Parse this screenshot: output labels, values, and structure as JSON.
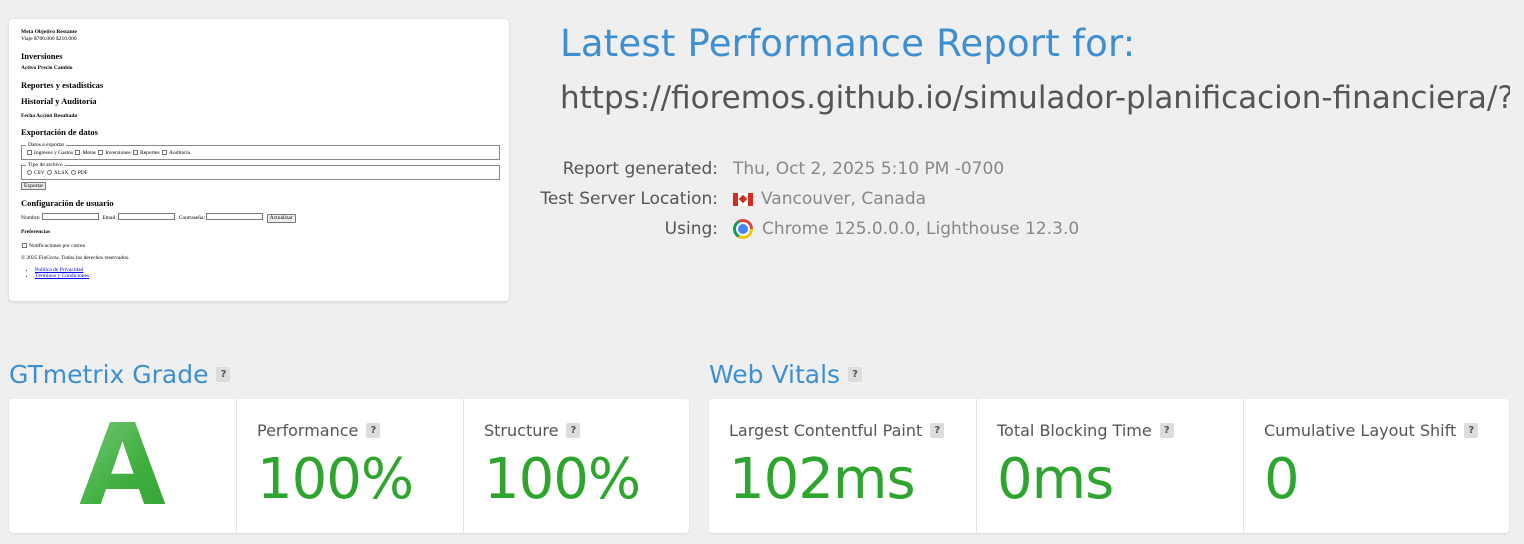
{
  "report": {
    "title": "Latest Performance Report for:",
    "url": "https://fioremos.github.io/simulador-planificacion-financiera/?...",
    "meta": [
      {
        "label": "Report generated:",
        "value": "Thu, Oct 2, 2025 5:10 PM -0700",
        "icon": "none"
      },
      {
        "label": "Test Server Location:",
        "value": "Vancouver, Canada",
        "icon": "canada-flag-icon"
      },
      {
        "label": "Using:",
        "value": "Chrome 125.0.0.0, Lighthouse 12.3.0",
        "icon": "chrome-icon"
      }
    ]
  },
  "thumbnail": {
    "line1": "Meta Objetivo Restante",
    "line2": "Viaje $700.000 $210.000",
    "h_inversiones": "Inversiones",
    "inv_cols": "Activo Precio Cambio",
    "h_reportes": "Reportes y estadísticas",
    "h_historial": "Historial y Auditoría",
    "hist_cols": "Fecha Acción Resultado",
    "h_export": "Exportación de datos",
    "legend_datos": "Datos a exportar",
    "datos_opts": [
      "Ingresos y Gastos",
      "Metas",
      "Inversiones",
      "Reportes",
      "Auditoría"
    ],
    "legend_tipo": "Tipo de archivo",
    "tipo_opts": [
      "CSV",
      "XLSX",
      "PDF"
    ],
    "export_btn": "Exportar",
    "h_config": "Configuración de usuario",
    "lbl_nombre": "Nombre:",
    "lbl_email": "Email:",
    "lbl_pass": "Contraseña:",
    "update_btn": "Actualizar",
    "h_pref": "Preferencias",
    "notif": "Notificaciones por correo",
    "copyright": "© 2025 FinGrow. Todos los derechos reservados.",
    "links": [
      "Política de Privacidad",
      "Términos y Condiciones"
    ]
  },
  "grade": {
    "section_title": "GTmetrix Grade",
    "letter": "A",
    "performance_label": "Performance",
    "performance_value": "100%",
    "structure_label": "Structure",
    "structure_value": "100%"
  },
  "vitals": {
    "section_title": "Web Vitals",
    "lcp_label": "Largest Contentful Paint",
    "lcp_value": "102ms",
    "tbt_label": "Total Blocking Time",
    "tbt_value": "0ms",
    "cls_label": "Cumulative Layout Shift",
    "cls_value": "0"
  },
  "help_glyph": "?",
  "colors": {
    "accent_blue": "#3d8fd1",
    "good_green": "#2ea52e",
    "background": "#efefef"
  }
}
